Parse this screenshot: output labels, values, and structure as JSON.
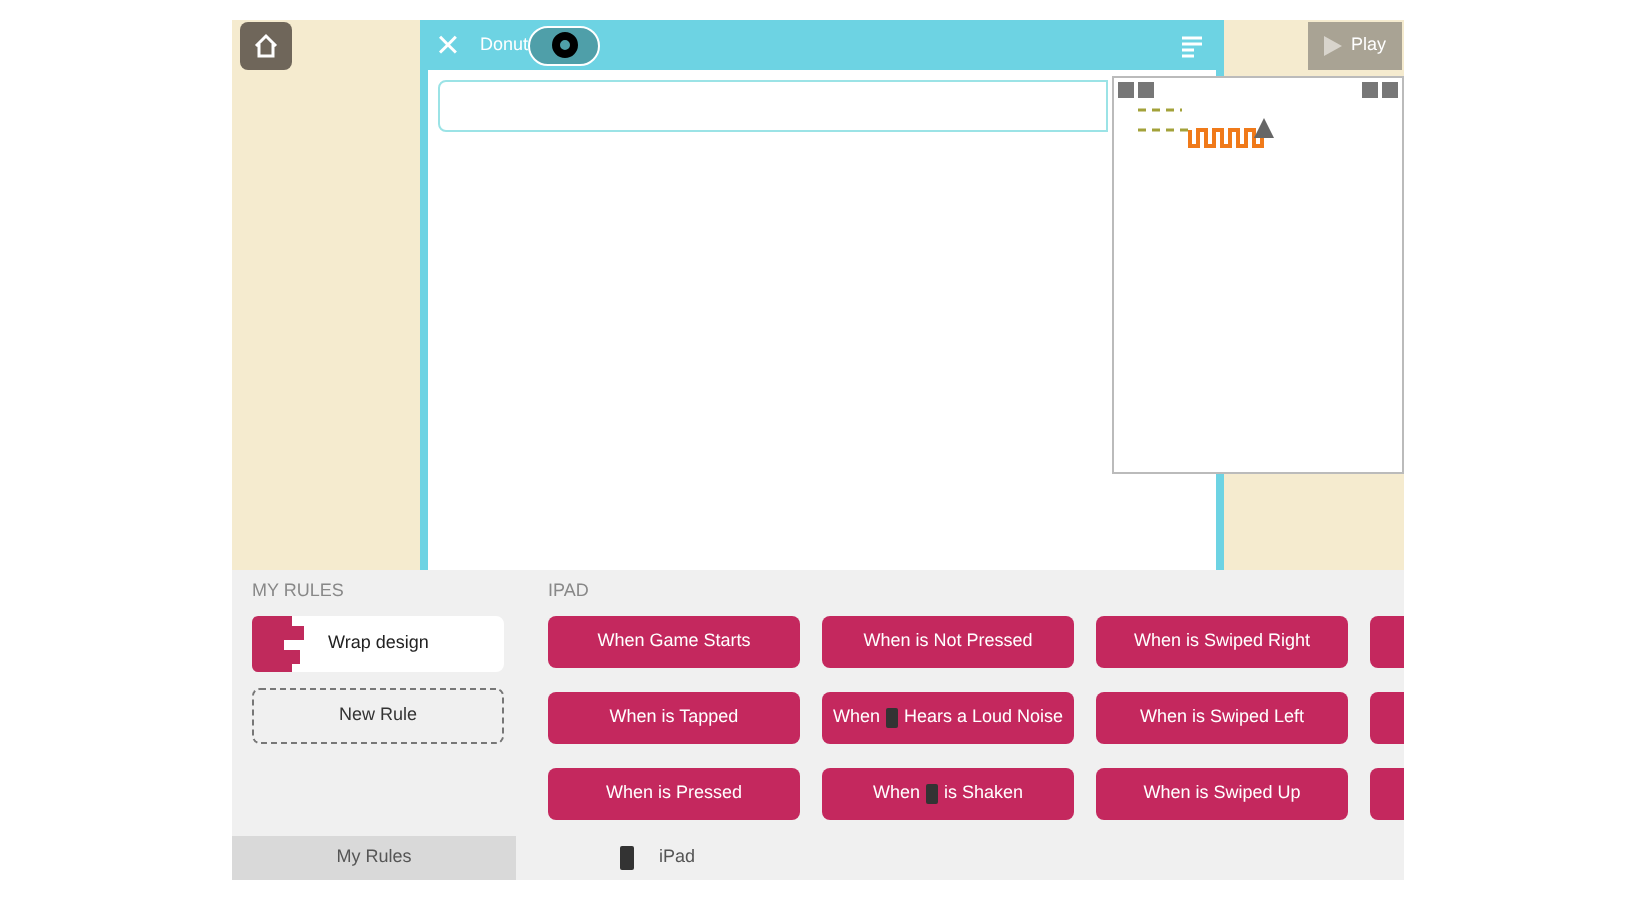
{
  "editor": {
    "close": "×",
    "title": "Donut",
    "play": "Play"
  },
  "my_rules": {
    "heading": "MY RULES",
    "rules": [
      {
        "label": "Wrap design"
      }
    ],
    "new_rule": "New Rule"
  },
  "ipad": {
    "heading": "IPAD",
    "triggers": [
      {
        "kind": "text",
        "label": "When Game Starts"
      },
      {
        "kind": "text",
        "label": "When is Not Pressed"
      },
      {
        "kind": "text",
        "label": "When is Swiped Right"
      },
      {
        "kind": "cut"
      },
      {
        "kind": "text",
        "label": "When is Tapped"
      },
      {
        "kind": "device",
        "before": "When",
        "after": "Hears a Loud Noise"
      },
      {
        "kind": "text",
        "label": "When is Swiped Left"
      },
      {
        "kind": "cut"
      },
      {
        "kind": "text",
        "label": "When is Pressed"
      },
      {
        "kind": "device",
        "before": "When",
        "after": "is Shaken"
      },
      {
        "kind": "text",
        "label": "When is Swiped Up"
      },
      {
        "kind": "cut"
      }
    ]
  },
  "bottom_tabs": [
    {
      "label": "My Rules",
      "kind": "plain",
      "selected": true
    },
    {
      "label": "iPad",
      "kind": "device",
      "selected": false
    }
  ]
}
